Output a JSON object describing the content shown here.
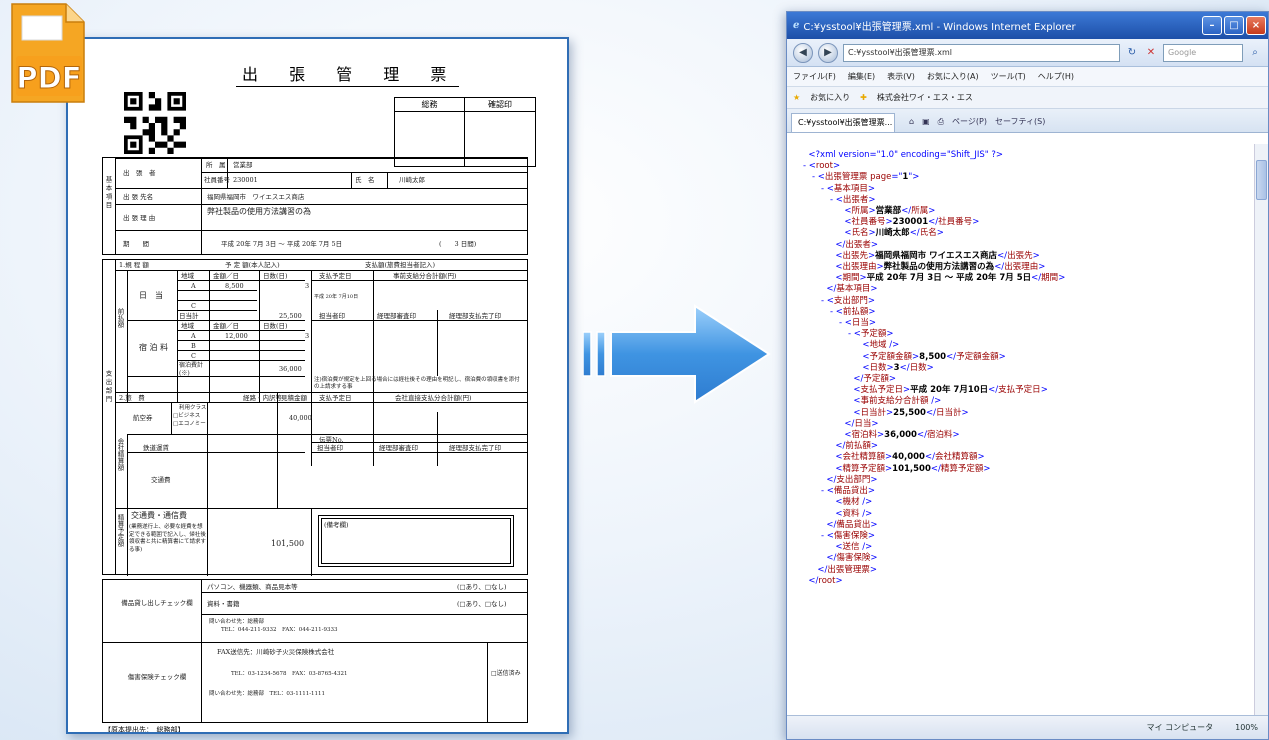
{
  "pdf_icon": {
    "label": "PDF"
  },
  "form": {
    "title": "出 張 管 理 票",
    "stamp": {
      "col1": "総務",
      "col2": "確認印"
    },
    "basic": {
      "section": "基本項目",
      "traveler_label": "出　張　者",
      "dept_label": "所　属",
      "dept_value": "営業部",
      "empno_label": "社員番号",
      "empno_value": "230001",
      "name_label": "氏　名",
      "name_value": "川崎太郎",
      "dest_label": "出 張 先名",
      "dest_value": "福岡県福岡市　ワイエスエス商店",
      "reason_label": "出 張 理 由",
      "reason_value": "弊社製品の使用方法講習の為",
      "period_label": "期　　間",
      "period_value": "平成 20年 7月 3日 ～ 平成 20年 7月 5日",
      "period_days": "(　　3 日間)"
    },
    "expense": {
      "section": "支出部門",
      "sub1": "1.規 程 額",
      "prepaid": "前払額",
      "planned": "予 定 額(本人記入)",
      "payment_col": "支払額(旅費担当者記入)",
      "region": "地域",
      "amount_per_day": "金額／日",
      "days": "日数(日)",
      "pay_date": "支払予定日",
      "pre_payment_total": "事前支給分合計額(円)",
      "daily": "日　当",
      "row_a": "A",
      "row_b": "B",
      "row_c": "C",
      "daily_amount": "8,500",
      "daily_days": "3",
      "daily_subtotal_label": "日当計",
      "daily_subtotal": "25,500",
      "pay_date_value": "平成 20年 7月10日",
      "person_stamp": "担当者印",
      "acct_stamp": "経理部審査印",
      "acct_done": "経理部支払完了印",
      "lodging": "宿 泊 料",
      "lodging_amount": "12,000",
      "lodging_days": "3",
      "lodging_subtotal_label": "宿泊費計(※)",
      "lodging_subtotal": "36,000",
      "lodging_note": "注)宿泊費が規定を上回る場合には経社後その理由を明記し、宿泊費の領収書を添付の上請求する事",
      "sub2": "2.旅　費",
      "route": "経路・内訳等",
      "estimate": "見積金額",
      "company_payment": "会社直接支払分合計額(円)",
      "settlement": "会社精算額",
      "air": "航空券",
      "air_class_label": "利用クラス",
      "air_class_options": "□ビジネス □エコノミー",
      "air_amount": "40,000",
      "voucher": "伝票No.",
      "rail": "鉄道運賃",
      "transport": "交通費",
      "estimate_section": "精算予定額",
      "comm": "交通費・通信費",
      "comm_note": "(業務遂行上、必要な経費を想定できる範囲で記入し、帰社後領収書と共に精算書にて請求する事)",
      "comm_total": "101,500",
      "remarks": "(備考欄)"
    },
    "lending": {
      "label": "備品貸し出しチェック欄",
      "item1": "パソコン、機器類、商品見本等",
      "item1_check": "(□あり、□なし)",
      "item2": "資料・書籍",
      "item2_check": "(□あり、□なし)",
      "contact": "問い合わせ先：総務部",
      "contact_tel": "TEL：044-211-9332　FAX：044-211-9333"
    },
    "insurance": {
      "label": "傷害保険チェック欄",
      "fax": "FAX送信先：川崎砂子火災保険株式会社",
      "fax_tel": "TEL：03-1234-5678　FAX：03-8765-4321",
      "contact": "問い合わせ先：総務部　TEL：03-1111-1111",
      "sent": "□送信済み"
    },
    "footer": "【原本提出先：　総務部】"
  },
  "browser": {
    "title": "C:¥ysstool¥出張管理票.xml - Windows Internet Explorer",
    "address": "C:¥ysstool¥出張管理票.xml",
    "search_placeholder": "Google",
    "menu": [
      "ファイル(F)",
      "編集(E)",
      "表示(V)",
      "お気に入り(A)",
      "ツール(T)",
      "ヘルプ(H)"
    ],
    "favorites": [
      "お気に入り",
      "株式会社ワイ・エス・エス"
    ],
    "tab_label": "C:¥ysstool¥出張管理票...",
    "tools": [
      "ページ(P)",
      "セーフティ(S)"
    ],
    "status_zone": "マイ コンピュータ",
    "zoom": "100%",
    "xml_lines": [
      {
        "indent": 0,
        "type": "pi",
        "text": "<?xml version=\"1.0\" encoding=\"Shift_JIS\" ?>"
      },
      {
        "indent": 0,
        "type": "open",
        "tag": "root"
      },
      {
        "indent": 1,
        "type": "openattr",
        "tag": "出張管理票",
        "attr": "page",
        "val": "1"
      },
      {
        "indent": 2,
        "type": "open",
        "tag": "基本項目"
      },
      {
        "indent": 3,
        "type": "open",
        "tag": "出張者"
      },
      {
        "indent": 4,
        "type": "elem",
        "tag": "所属",
        "val": "営業部"
      },
      {
        "indent": 4,
        "type": "elem",
        "tag": "社員番号",
        "val": "230001"
      },
      {
        "indent": 4,
        "type": "elem",
        "tag": "氏名",
        "val": "川崎太郎"
      },
      {
        "indent": 3,
        "type": "close",
        "tag": "出張者"
      },
      {
        "indent": 3,
        "type": "elem",
        "tag": "出張先",
        "val": "福岡県福岡市 ワイエスエス商店"
      },
      {
        "indent": 3,
        "type": "elem",
        "tag": "出張理由",
        "val": "弊社製品の使用方法講習の為"
      },
      {
        "indent": 3,
        "type": "elem",
        "tag": "期間",
        "val": "平成 20年 7月 3日 ～ 平成 20年 7月 5日"
      },
      {
        "indent": 2,
        "type": "close",
        "tag": "基本項目"
      },
      {
        "indent": 2,
        "type": "open",
        "tag": "支出部門"
      },
      {
        "indent": 3,
        "type": "open",
        "tag": "前払額"
      },
      {
        "indent": 4,
        "type": "open",
        "tag": "日当"
      },
      {
        "indent": 5,
        "type": "open",
        "tag": "予定額"
      },
      {
        "indent": 6,
        "type": "empty",
        "tag": "地域"
      },
      {
        "indent": 6,
        "type": "elem",
        "tag": "予定額金額",
        "val": "8,500"
      },
      {
        "indent": 6,
        "type": "elem",
        "tag": "日数",
        "val": "3"
      },
      {
        "indent": 5,
        "type": "close",
        "tag": "予定額"
      },
      {
        "indent": 5,
        "type": "elem",
        "tag": "支払予定日",
        "val": "平成 20年 7月10日"
      },
      {
        "indent": 5,
        "type": "empty",
        "tag": "事前支給分合計額"
      },
      {
        "indent": 5,
        "type": "elem",
        "tag": "日当計",
        "val": "25,500"
      },
      {
        "indent": 4,
        "type": "close",
        "tag": "日当"
      },
      {
        "indent": 4,
        "type": "elem",
        "tag": "宿泊料",
        "val": "36,000"
      },
      {
        "indent": 3,
        "type": "close",
        "tag": "前払額"
      },
      {
        "indent": 3,
        "type": "elem",
        "tag": "会社精算額",
        "val": "40,000"
      },
      {
        "indent": 3,
        "type": "elem",
        "tag": "精算予定額",
        "val": "101,500"
      },
      {
        "indent": 2,
        "type": "close",
        "tag": "支出部門"
      },
      {
        "indent": 2,
        "type": "open",
        "tag": "備品貸出"
      },
      {
        "indent": 3,
        "type": "empty",
        "tag": "機材"
      },
      {
        "indent": 3,
        "type": "empty",
        "tag": "資料"
      },
      {
        "indent": 2,
        "type": "close",
        "tag": "備品貸出"
      },
      {
        "indent": 2,
        "type": "open",
        "tag": "傷害保険"
      },
      {
        "indent": 3,
        "type": "empty",
        "tag": "送信"
      },
      {
        "indent": 2,
        "type": "close",
        "tag": "傷害保険"
      },
      {
        "indent": 1,
        "type": "close",
        "tag": "出張管理票"
      },
      {
        "indent": 0,
        "type": "close",
        "tag": "root"
      }
    ]
  },
  "colors": {
    "accent": "#2f6db5",
    "pdf_orange": "#f5a623",
    "arrow": "#4a97df"
  }
}
